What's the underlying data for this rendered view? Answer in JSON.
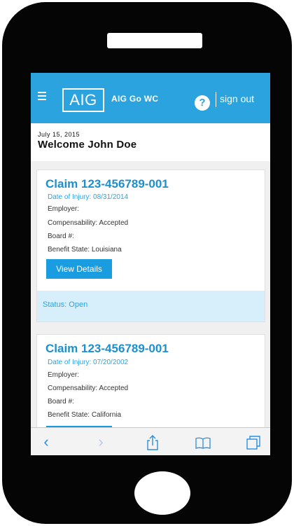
{
  "header": {
    "logo_text": "AIG",
    "app_title": "AIG Go WC",
    "help_icon_glyph": "?",
    "signout_label": "sign out",
    "color": "#2aa3df"
  },
  "welcome": {
    "date": "July 15, 2015",
    "greeting": "Welcome John Doe"
  },
  "claims": [
    {
      "title": "Claim 123-456789-001",
      "injury_date": "Date of Injury: 08/31/2014",
      "employer": "Employer:",
      "compensability": "Compensability: Accepted",
      "board": "Board #:",
      "benefit_state": "Benefit State: Louisiana",
      "button_label": "View Details",
      "status": "Status: Open"
    },
    {
      "title": "Claim 123-456789-001",
      "injury_date": "Date of Injury: 07/20/2002",
      "employer": "Employer:",
      "compensability": "Compensability: Accepted",
      "board": "Board #:",
      "benefit_state": "Benefit State: California"
    }
  ],
  "toolbar": {
    "back_icon": "‹",
    "forward_icon": "›",
    "share_icon": "share-icon",
    "bookmarks_icon": "book-icon",
    "tabs_icon": "tabs-icon",
    "color": "#2a8fe0"
  }
}
